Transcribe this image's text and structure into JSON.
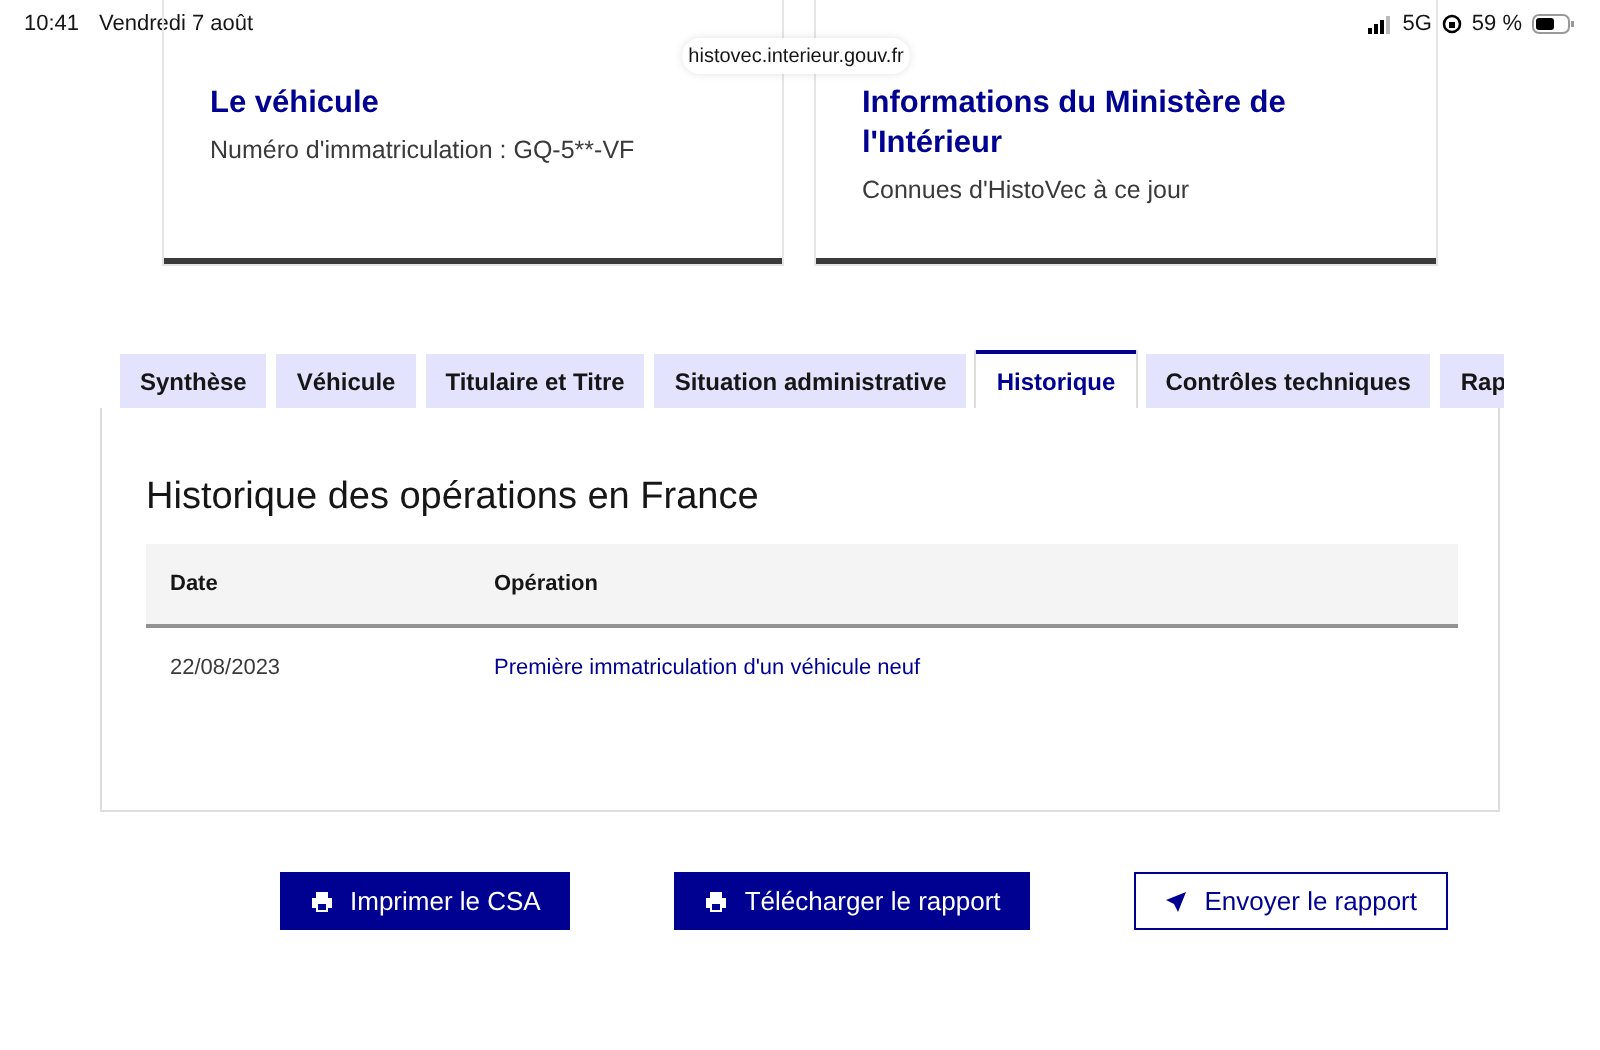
{
  "status_bar": {
    "time": "10:41",
    "date": "Vendredi 7 août",
    "network": "5G",
    "battery": "59 %"
  },
  "url": "histovec.interieur.gouv.fr",
  "cards": [
    {
      "title": "Le véhicule",
      "text": "Numéro d'immatriculation : GQ-5**-VF"
    },
    {
      "title": "Informations du Ministère de l'Intérieur",
      "text": "Connues d'HistoVec à ce jour"
    }
  ],
  "tabs": [
    {
      "label": "Synthèse",
      "selected": false
    },
    {
      "label": "Véhicule",
      "selected": false
    },
    {
      "label": "Titulaire et Titre",
      "selected": false
    },
    {
      "label": "Situation administrative",
      "selected": false
    },
    {
      "label": "Historique",
      "selected": true
    },
    {
      "label": "Contrôles techniques",
      "selected": false
    },
    {
      "label": "Rap",
      "selected": false
    }
  ],
  "panel": {
    "title": "Historique des opérations en France",
    "table": {
      "columns": [
        "Date",
        "Opération"
      ],
      "rows": [
        [
          "22/08/2023",
          "Première immatriculation d'un véhicule neuf"
        ]
      ]
    }
  },
  "buttons": [
    {
      "label": "Imprimer le CSA",
      "kind": "print"
    },
    {
      "label": "Télécharger le rapport",
      "kind": "print"
    },
    {
      "label": "Envoyer le rapport",
      "kind": "send"
    }
  ]
}
